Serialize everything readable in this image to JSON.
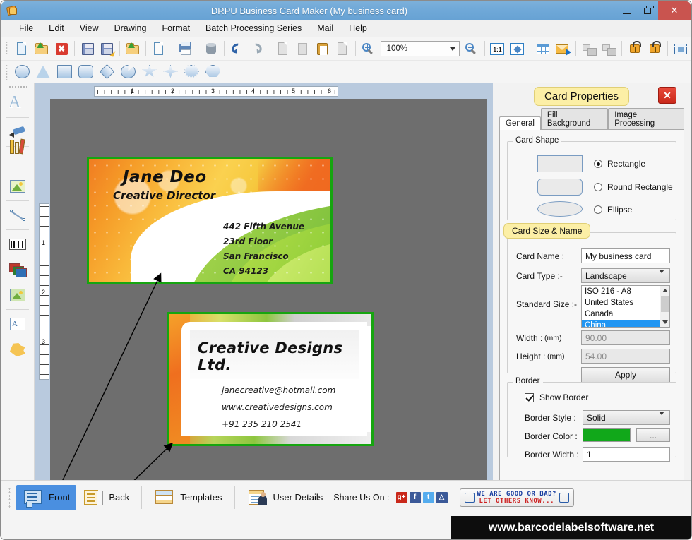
{
  "window": {
    "title": "DRPU Business Card Maker (My business card)",
    "minimize": "–",
    "maximize": "❐",
    "close": "✕"
  },
  "menubar": {
    "items": [
      {
        "label": "File"
      },
      {
        "label": "Edit"
      },
      {
        "label": "View"
      },
      {
        "label": "Drawing"
      },
      {
        "label": "Format"
      },
      {
        "label": "Batch Processing Series"
      },
      {
        "label": "Mail"
      },
      {
        "label": "Help"
      }
    ]
  },
  "toolbar": {
    "zoom_value": "100%",
    "icons": [
      "new-document-icon",
      "open-folder-icon",
      "close-document-icon",
      "save-icon",
      "save-as-icon",
      "open-template-icon",
      "properties-icon",
      "print-icon",
      "database-icon",
      "undo-icon",
      "redo-icon",
      "copy-icon",
      "cut-icon",
      "paste-icon",
      "delete-icon",
      "zoom-in-icon",
      "zoom-out-icon",
      "actual-size-icon",
      "fit-page-icon",
      "grid-icon",
      "email-icon",
      "group-icon",
      "ungroup-icon",
      "lock-icon",
      "unlock-icon",
      "select-all-icon"
    ],
    "shapes": [
      "ellipse-shape",
      "triangle-shape",
      "rectangle-shape",
      "round-rectangle-shape",
      "diamond-shape",
      "pacman-shape",
      "star5-shape",
      "star4-shape",
      "burst-shape",
      "heptagon-shape"
    ]
  },
  "left_palette": {
    "tools": [
      {
        "name": "text-tool-icon",
        "label": "Text"
      },
      {
        "name": "signature-tool-icon",
        "label": "Signature"
      },
      {
        "name": "library-tool-icon",
        "label": "Library"
      },
      {
        "name": "image-tool-icon",
        "label": "Image"
      },
      {
        "name": "line-tool-icon",
        "label": "Line"
      },
      {
        "name": "barcode-tool-icon",
        "label": "Barcode"
      },
      {
        "name": "layers-tool-icon",
        "label": "Layers"
      },
      {
        "name": "picture-tool-icon",
        "label": "Picture"
      },
      {
        "name": "watermark-tool-icon",
        "label": "Watermark"
      },
      {
        "name": "shape-tool-icon",
        "label": "Shape"
      }
    ]
  },
  "canvas": {
    "h_ruler_labels": [
      "1",
      "2",
      "3",
      "4",
      "5",
      "6"
    ],
    "v_ruler_labels": [
      "1",
      "2",
      "3"
    ],
    "card_front": {
      "name": "Jane Deo",
      "role": "Creative Director",
      "address_lines": [
        "442 Fifth Avenue",
        "23rd Floor",
        "San Francisco",
        "CA 94123"
      ]
    },
    "card_back": {
      "company": "Creative Designs Ltd.",
      "contact_lines": [
        "janecreative@hotmail.com",
        "www.creativedesigns.com",
        "+91 235 210 2541"
      ]
    }
  },
  "properties": {
    "title": "Card Properties",
    "close_label": "✕",
    "tabs": [
      {
        "label": "General",
        "active": true
      },
      {
        "label": "Fill Background",
        "active": false
      },
      {
        "label": "Image Processing",
        "active": false
      }
    ],
    "card_shape": {
      "legend": "Card Shape",
      "options": [
        {
          "label": "Rectangle",
          "selected": true
        },
        {
          "label": "Round Rectangle",
          "selected": false
        },
        {
          "label": "Ellipse",
          "selected": false
        }
      ]
    },
    "card_size": {
      "legend": "Card Size & Name",
      "card_name_label": "Card Name :",
      "card_name_value": "My business card",
      "card_type_label": "Card Type :-",
      "card_type_value": "Landscape",
      "standard_size_label": "Standard Size :-",
      "standard_size_options": [
        "ISO 216 - A8",
        "United States",
        "Canada",
        "China"
      ],
      "standard_size_selected": "China",
      "width_label": "Width :",
      "width_unit": "(mm)",
      "width_value": "90.00",
      "height_label": "Height :",
      "height_unit": "(mm)",
      "height_value": "54.00",
      "apply_label": "Apply"
    },
    "border": {
      "legend": "Border",
      "show_border_label": "Show Border",
      "show_border_checked": true,
      "style_label": "Border Style :",
      "style_value": "Solid",
      "color_label": "Border Color :",
      "color_value": "#11a81a",
      "color_picker_label": "...",
      "width_label": "Border Width :",
      "width_value": "1"
    }
  },
  "bottombar": {
    "buttons": [
      {
        "label": "Front",
        "active": true,
        "icon": "card-front-icon"
      },
      {
        "label": "Back",
        "active": false,
        "icon": "card-back-icon"
      },
      {
        "label": "Templates",
        "active": false,
        "icon": "templates-icon"
      },
      {
        "label": "User Details",
        "active": false,
        "icon": "user-details-icon"
      }
    ],
    "share_label": "Share Us On :",
    "share_icons": [
      {
        "name": "google-plus-icon",
        "glyph": "g+",
        "color": "#c9281a"
      },
      {
        "name": "facebook-icon",
        "glyph": "f",
        "color": "#3b5998"
      },
      {
        "name": "twitter-icon",
        "glyph": "t",
        "color": "#55acee"
      },
      {
        "name": "like-icon",
        "glyph": "△",
        "color": "#3b5998"
      }
    ],
    "feedback_line1": "WE ARE GOOD OR BAD?",
    "feedback_line2": "LET OTHERS KNOW..."
  },
  "watermark": {
    "text": "www.barcodelabelsoftware.net"
  }
}
